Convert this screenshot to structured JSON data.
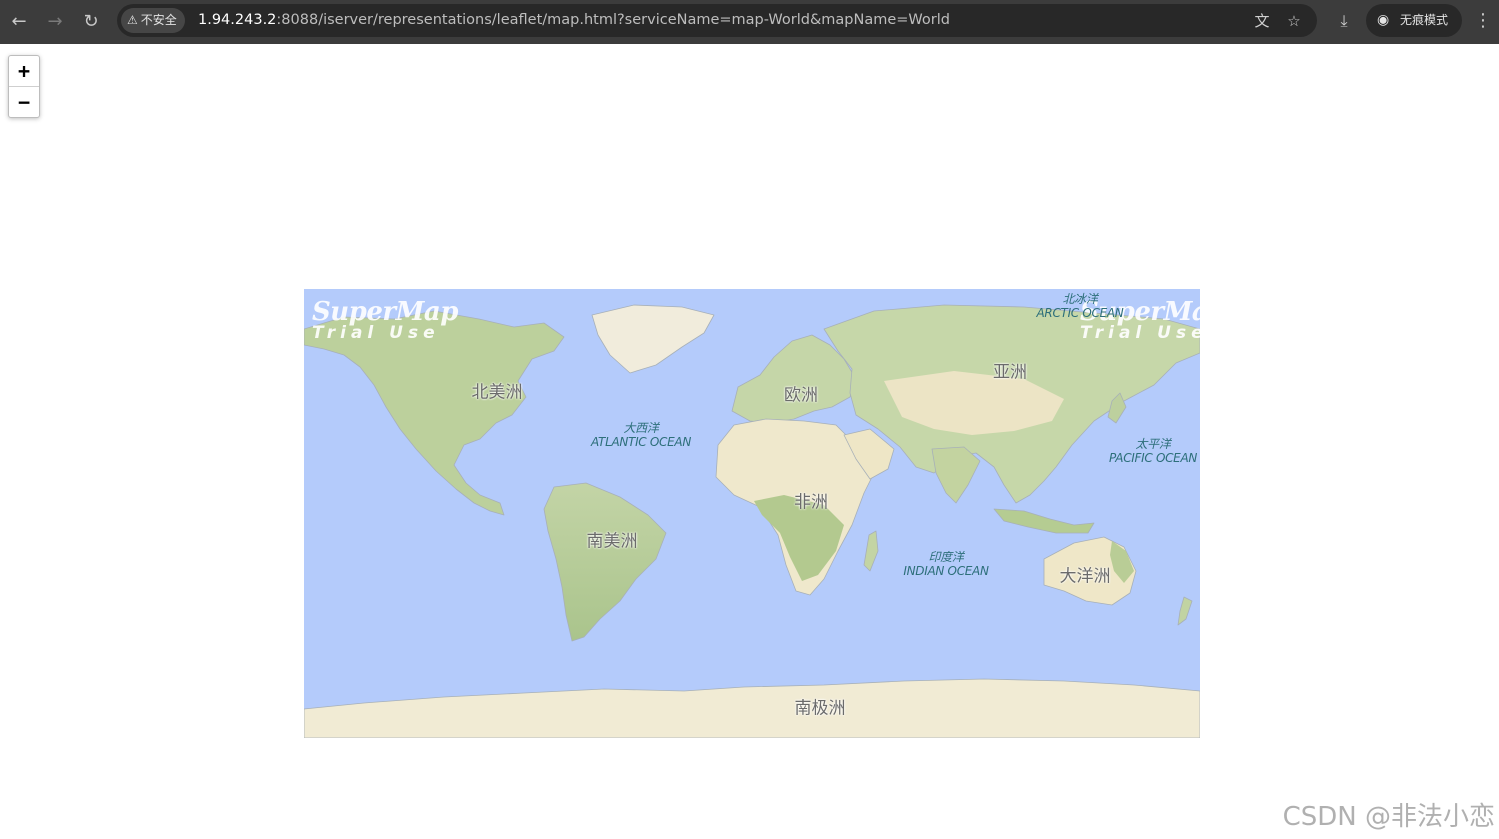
{
  "browser": {
    "security_label": "不安全",
    "url_host": "1.94.243.2",
    "url_rest": ":8088/iserver/representations/leaflet/map.html?serviceName=map-World&mapName=World",
    "incognito_label": "无痕模式"
  },
  "zoom": {
    "in_label": "+",
    "out_label": "−"
  },
  "map": {
    "continents": [
      "北美洲",
      "南美洲",
      "欧洲",
      "非洲",
      "亚洲",
      "大洋洲",
      "南极洲"
    ],
    "oceans": {
      "arctic": {
        "zh": "北冰洋",
        "en": "ARCTIC OCEAN"
      },
      "atlantic": {
        "zh": "大西洋",
        "en": "ATLANTIC OCEAN"
      },
      "pacific": {
        "zh": "太平洋",
        "en": "PACIFIC OCEAN"
      },
      "indian": {
        "zh": "印度洋",
        "en": "INDIAN OCEAN"
      }
    },
    "watermark": {
      "brand": "SuperMap",
      "sub": "Trial Use"
    }
  },
  "csdn_watermark": "CSDN @非法小恋",
  "colors": {
    "ocean": "#b4cbfb",
    "land_green": "#b9cf98",
    "land_sand": "#eee6c8",
    "chrome": "#3c3c3c"
  }
}
